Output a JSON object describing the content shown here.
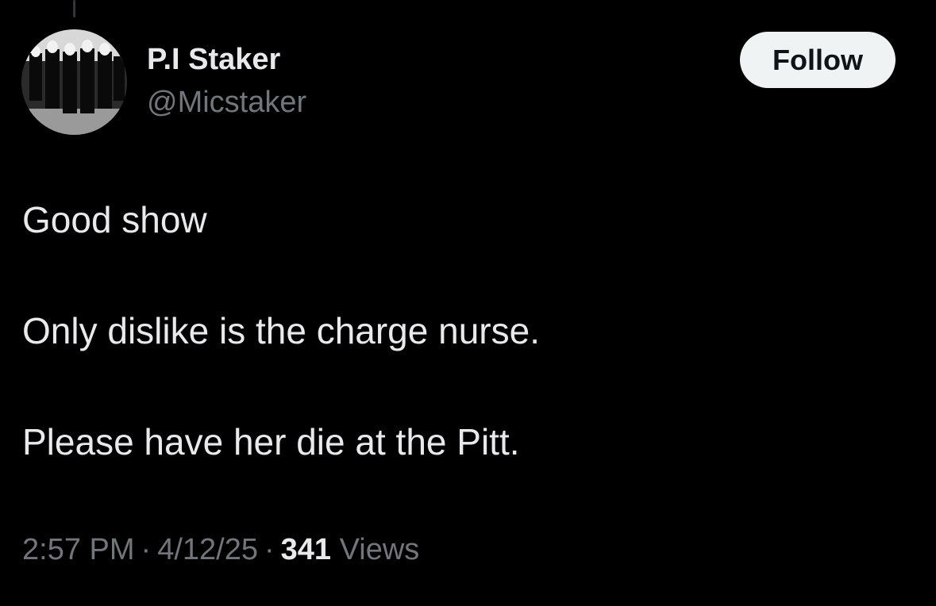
{
  "tweet": {
    "author": {
      "display_name": "P.I Staker",
      "handle": "@Micstaker",
      "avatar": "group-in-suits-photo"
    },
    "follow_label": "Follow",
    "body_lines": [
      "Good show",
      "Only dislike is the charge nurse.",
      "Please have her die at the Pitt."
    ],
    "meta": {
      "time": "2:57 PM",
      "separator": "·",
      "date": "4/12/25",
      "views_count": "341",
      "views_label": "Views"
    }
  },
  "colors": {
    "background": "#000000",
    "primary_text": "#e7e9ea",
    "secondary_text": "#71767b",
    "follow_button_bg": "#eff3f4",
    "follow_button_text": "#0f1419"
  }
}
